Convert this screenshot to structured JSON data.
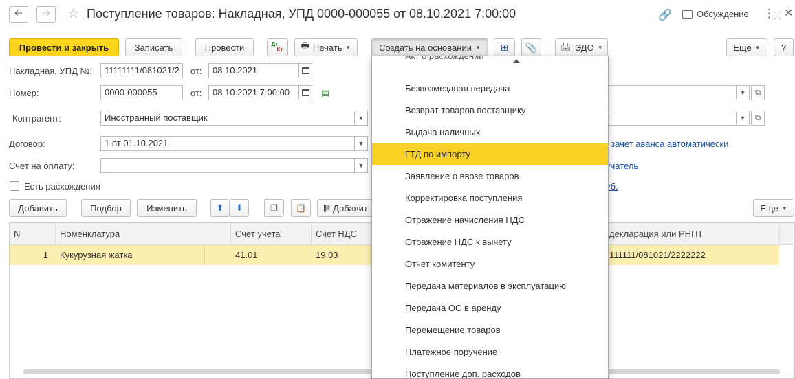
{
  "window": {
    "title": "Поступление товаров: Накладная, УПД 0000-000055 от 08.10.2021 7:00:00",
    "discuss_label": "Обсуждение",
    "icons": [
      "back-arrow-icon",
      "forward-arrow-icon",
      "star-icon",
      "link-icon",
      "discussion-icon",
      "kebab-menu-icon",
      "maximize-icon",
      "close-icon"
    ]
  },
  "toolbar": {
    "post_close": "Провести и закрыть",
    "save": "Записать",
    "post": "Провести",
    "dtkt_dt": "Дт",
    "dtkt_kt": "Кт",
    "print": "Печать",
    "create_based": "Создать на основании",
    "edo": "ЭДО",
    "more": "Еще",
    "help": "?"
  },
  "form": {
    "invoice_label": "Накладная, УПД №:",
    "invoice_value": "11111111/081021/2",
    "from_label": "от:",
    "invoice_date": "08.10.2021",
    "number_label": "Номер:",
    "number_value": "0000-000055",
    "number_datetime": "08.10.2021  7:00:00",
    "counterparty_label": "Контрагент:",
    "counterparty_value": "Иностранный поставщик",
    "contract_label": "Договор:",
    "contract_value": "1 от 01.10.2021",
    "payment_label": "Счет на оплату:",
    "payment_value": "",
    "advance_link": ", зачет аванса автоматически",
    "recipient_link": "учатель",
    "rub_link": "уб.",
    "discrepancies_label": "Есть расхождения"
  },
  "table_toolbar": {
    "add": "Добавить",
    "pick": "Подбор",
    "change": "Изменить",
    "add_barcode": "Добавит",
    "more": "Еще"
  },
  "table": {
    "columns": [
      "N",
      "Номенклатура",
      "Счет учета",
      "Счет НДС",
      "декларация или РНПТ"
    ],
    "rows": [
      {
        "n": "1",
        "item": "Кукурузная жатка",
        "account": "41.01",
        "vat_account": "19.03",
        "declaration": "111111/081021/2222222"
      }
    ]
  },
  "dropdown": {
    "clipped_top": "Акт о расхождении",
    "items": [
      "Безвозмездная передача",
      "Возврат товаров поставщику",
      "Выдача наличных",
      "ГТД по импорту",
      "Заявление о ввозе товаров",
      "Корректировка поступления",
      "Отражение начисления НДС",
      "Отражение НДС к вычету",
      "Отчет комитенту",
      "Передача материалов в эксплуатацию",
      "Передача ОС в аренду",
      "Перемещение товаров",
      "Платежное поручение",
      "Поступление доп. расходов"
    ],
    "selected": "ГТД по импорту"
  },
  "colors": {
    "primary_button": "#fcd51c",
    "selected_row": "#fbeeb0",
    "menu_highlight": "#f9d024",
    "link": "#1a4e9e"
  }
}
